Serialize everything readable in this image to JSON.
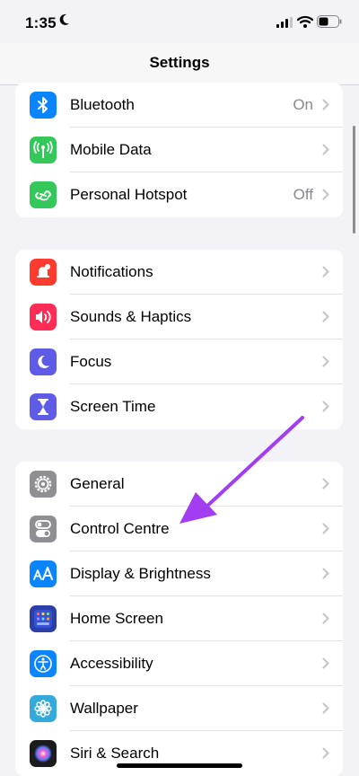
{
  "status_bar": {
    "time": "1:35"
  },
  "nav": {
    "title": "Settings"
  },
  "groups": [
    {
      "rows": [
        {
          "label": "Bluetooth",
          "value": "On",
          "icon": "bluetooth-icon",
          "color": "#0a84ff"
        },
        {
          "label": "Mobile Data",
          "value": "",
          "icon": "antenna-icon",
          "color": "#34c759"
        },
        {
          "label": "Personal Hotspot",
          "value": "Off",
          "icon": "hotspot-icon",
          "color": "#34c759"
        }
      ]
    },
    {
      "rows": [
        {
          "label": "Notifications",
          "icon": "bell-icon",
          "color": "#ff3b30"
        },
        {
          "label": "Sounds & Haptics",
          "icon": "speaker-icon",
          "color": "#ff2d55"
        },
        {
          "label": "Focus",
          "icon": "moon-icon",
          "color": "#5e5ce6"
        },
        {
          "label": "Screen Time",
          "icon": "hourglass-icon",
          "color": "#5e5ce6"
        }
      ]
    },
    {
      "rows": [
        {
          "label": "General",
          "icon": "gear-icon",
          "color": "#8e8e93"
        },
        {
          "label": "Control Centre",
          "icon": "toggles-icon",
          "color": "#8e8e93"
        },
        {
          "label": "Display & Brightness",
          "icon": "text-size-icon",
          "color": "#0a84ff"
        },
        {
          "label": "Home Screen",
          "icon": "app-grid-icon",
          "color": "#2c3ea8"
        },
        {
          "label": "Accessibility",
          "icon": "accessibility-icon",
          "color": "#0a84ff"
        },
        {
          "label": "Wallpaper",
          "icon": "flower-icon",
          "color": "#34aadc"
        },
        {
          "label": "Siri & Search",
          "icon": "siri-icon",
          "color": "#1c1c1e"
        }
      ]
    }
  ]
}
